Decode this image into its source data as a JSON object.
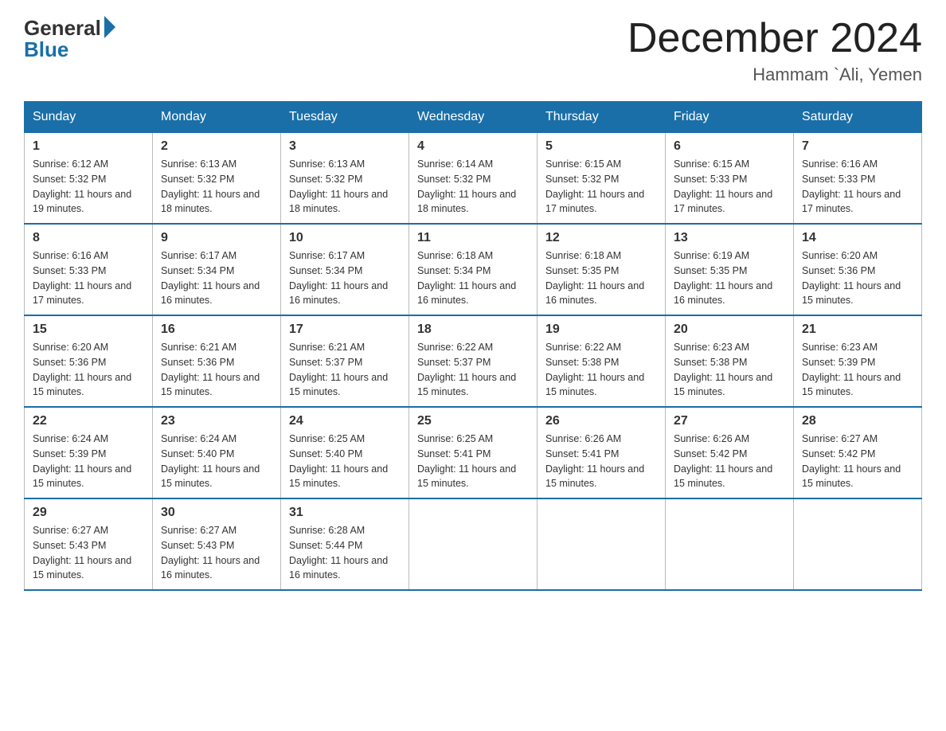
{
  "header": {
    "logo_general": "General",
    "logo_blue": "Blue",
    "month_year": "December 2024",
    "location": "Hammam `Ali, Yemen"
  },
  "days_of_week": [
    "Sunday",
    "Monday",
    "Tuesday",
    "Wednesday",
    "Thursday",
    "Friday",
    "Saturday"
  ],
  "weeks": [
    [
      {
        "day": "1",
        "sunrise": "6:12 AM",
        "sunset": "5:32 PM",
        "daylight": "11 hours and 19 minutes."
      },
      {
        "day": "2",
        "sunrise": "6:13 AM",
        "sunset": "5:32 PM",
        "daylight": "11 hours and 18 minutes."
      },
      {
        "day": "3",
        "sunrise": "6:13 AM",
        "sunset": "5:32 PM",
        "daylight": "11 hours and 18 minutes."
      },
      {
        "day": "4",
        "sunrise": "6:14 AM",
        "sunset": "5:32 PM",
        "daylight": "11 hours and 18 minutes."
      },
      {
        "day": "5",
        "sunrise": "6:15 AM",
        "sunset": "5:32 PM",
        "daylight": "11 hours and 17 minutes."
      },
      {
        "day": "6",
        "sunrise": "6:15 AM",
        "sunset": "5:33 PM",
        "daylight": "11 hours and 17 minutes."
      },
      {
        "day": "7",
        "sunrise": "6:16 AM",
        "sunset": "5:33 PM",
        "daylight": "11 hours and 17 minutes."
      }
    ],
    [
      {
        "day": "8",
        "sunrise": "6:16 AM",
        "sunset": "5:33 PM",
        "daylight": "11 hours and 17 minutes."
      },
      {
        "day": "9",
        "sunrise": "6:17 AM",
        "sunset": "5:34 PM",
        "daylight": "11 hours and 16 minutes."
      },
      {
        "day": "10",
        "sunrise": "6:17 AM",
        "sunset": "5:34 PM",
        "daylight": "11 hours and 16 minutes."
      },
      {
        "day": "11",
        "sunrise": "6:18 AM",
        "sunset": "5:34 PM",
        "daylight": "11 hours and 16 minutes."
      },
      {
        "day": "12",
        "sunrise": "6:18 AM",
        "sunset": "5:35 PM",
        "daylight": "11 hours and 16 minutes."
      },
      {
        "day": "13",
        "sunrise": "6:19 AM",
        "sunset": "5:35 PM",
        "daylight": "11 hours and 16 minutes."
      },
      {
        "day": "14",
        "sunrise": "6:20 AM",
        "sunset": "5:36 PM",
        "daylight": "11 hours and 15 minutes."
      }
    ],
    [
      {
        "day": "15",
        "sunrise": "6:20 AM",
        "sunset": "5:36 PM",
        "daylight": "11 hours and 15 minutes."
      },
      {
        "day": "16",
        "sunrise": "6:21 AM",
        "sunset": "5:36 PM",
        "daylight": "11 hours and 15 minutes."
      },
      {
        "day": "17",
        "sunrise": "6:21 AM",
        "sunset": "5:37 PM",
        "daylight": "11 hours and 15 minutes."
      },
      {
        "day": "18",
        "sunrise": "6:22 AM",
        "sunset": "5:37 PM",
        "daylight": "11 hours and 15 minutes."
      },
      {
        "day": "19",
        "sunrise": "6:22 AM",
        "sunset": "5:38 PM",
        "daylight": "11 hours and 15 minutes."
      },
      {
        "day": "20",
        "sunrise": "6:23 AM",
        "sunset": "5:38 PM",
        "daylight": "11 hours and 15 minutes."
      },
      {
        "day": "21",
        "sunrise": "6:23 AM",
        "sunset": "5:39 PM",
        "daylight": "11 hours and 15 minutes."
      }
    ],
    [
      {
        "day": "22",
        "sunrise": "6:24 AM",
        "sunset": "5:39 PM",
        "daylight": "11 hours and 15 minutes."
      },
      {
        "day": "23",
        "sunrise": "6:24 AM",
        "sunset": "5:40 PM",
        "daylight": "11 hours and 15 minutes."
      },
      {
        "day": "24",
        "sunrise": "6:25 AM",
        "sunset": "5:40 PM",
        "daylight": "11 hours and 15 minutes."
      },
      {
        "day": "25",
        "sunrise": "6:25 AM",
        "sunset": "5:41 PM",
        "daylight": "11 hours and 15 minutes."
      },
      {
        "day": "26",
        "sunrise": "6:26 AM",
        "sunset": "5:41 PM",
        "daylight": "11 hours and 15 minutes."
      },
      {
        "day": "27",
        "sunrise": "6:26 AM",
        "sunset": "5:42 PM",
        "daylight": "11 hours and 15 minutes."
      },
      {
        "day": "28",
        "sunrise": "6:27 AM",
        "sunset": "5:42 PM",
        "daylight": "11 hours and 15 minutes."
      }
    ],
    [
      {
        "day": "29",
        "sunrise": "6:27 AM",
        "sunset": "5:43 PM",
        "daylight": "11 hours and 15 minutes."
      },
      {
        "day": "30",
        "sunrise": "6:27 AM",
        "sunset": "5:43 PM",
        "daylight": "11 hours and 16 minutes."
      },
      {
        "day": "31",
        "sunrise": "6:28 AM",
        "sunset": "5:44 PM",
        "daylight": "11 hours and 16 minutes."
      },
      null,
      null,
      null,
      null
    ]
  ]
}
